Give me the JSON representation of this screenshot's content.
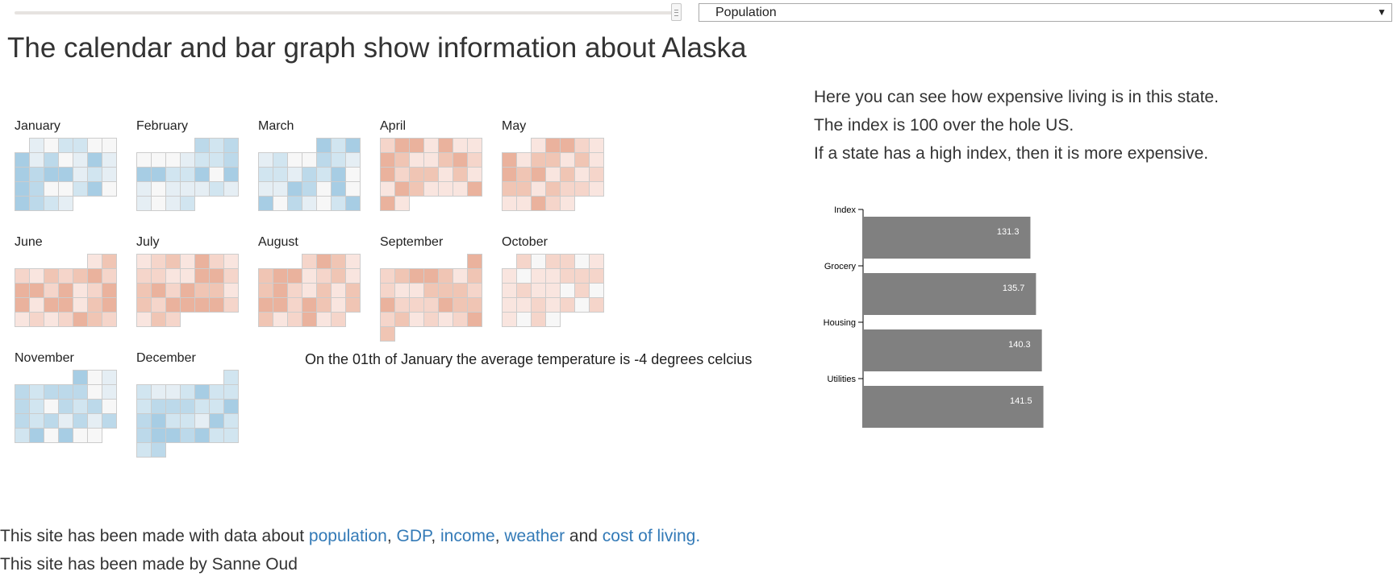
{
  "selector": {
    "selected": "Population"
  },
  "title": "The calendar and bar graph show information about Alaska",
  "calendar": {
    "months": [
      {
        "label": "January",
        "col": 0,
        "row": 0,
        "start": 1,
        "days": 31,
        "tone": "cold"
      },
      {
        "label": "February",
        "col": 1,
        "row": 0,
        "start": 4,
        "days": 28,
        "tone": "cold"
      },
      {
        "label": "March",
        "col": 2,
        "row": 0,
        "start": 4,
        "days": 31,
        "tone": "cold"
      },
      {
        "label": "April",
        "col": 3,
        "row": 0,
        "start": 0,
        "days": 30,
        "tone": "warm"
      },
      {
        "label": "May",
        "col": 4,
        "row": 0,
        "start": 2,
        "days": 31,
        "tone": "warm"
      },
      {
        "label": "June",
        "col": 0,
        "row": 1,
        "start": 5,
        "days": 30,
        "tone": "warm"
      },
      {
        "label": "July",
        "col": 1,
        "row": 1,
        "start": 0,
        "days": 31,
        "tone": "warm"
      },
      {
        "label": "August",
        "col": 2,
        "row": 1,
        "start": 3,
        "days": 31,
        "tone": "warm"
      },
      {
        "label": "September",
        "col": 3,
        "row": 1,
        "start": 6,
        "days": 30,
        "tone": "warm"
      },
      {
        "label": "October",
        "col": 4,
        "row": 1,
        "start": 1,
        "days": 31,
        "tone": "mild"
      },
      {
        "label": "November",
        "col": 0,
        "row": 2,
        "start": 4,
        "days": 30,
        "tone": "cold"
      },
      {
        "label": "December",
        "col": 1,
        "row": 2,
        "start": 6,
        "days": 31,
        "tone": "mixed"
      }
    ]
  },
  "day_info": "On the 01th of January the average temperature is -4 degrees celcius",
  "info": {
    "line1": "Here you can see how expensive living is in this state.",
    "line2": "The index is 100 over the hole US.",
    "line3": "If a state has a high index, then it is more expensive."
  },
  "chart_data": {
    "type": "bar",
    "categories": [
      "Index",
      "Grocery",
      "Housing",
      "Utilities"
    ],
    "values": [
      131.3,
      135.7,
      140.3,
      141.5
    ],
    "orientation": "horizontal",
    "bar_color": "#808080",
    "label_color": "#ffffff"
  },
  "footer": {
    "prefix": "This site has been made with data about ",
    "link_population": "population",
    "sep1": ", ",
    "link_gdp": "GDP",
    "sep2": ", ",
    "link_income": "income",
    "sep3": ", ",
    "link_weather": "weather",
    "and": " and ",
    "link_cost": "cost of living.",
    "credit": "This site has been made by Sanne Oud"
  },
  "colors": {
    "link": "#337ab7",
    "cell_stroke": "#cccccc",
    "cold_palette": [
      "#f7f7f7",
      "#e5eef4",
      "#d1e5f0",
      "#bcd9ea",
      "#a7cde4"
    ],
    "warm_palette": [
      "#f7f7f7",
      "#f9e5df",
      "#f5d5ca",
      "#f0c5b4",
      "#eab29d"
    ]
  }
}
